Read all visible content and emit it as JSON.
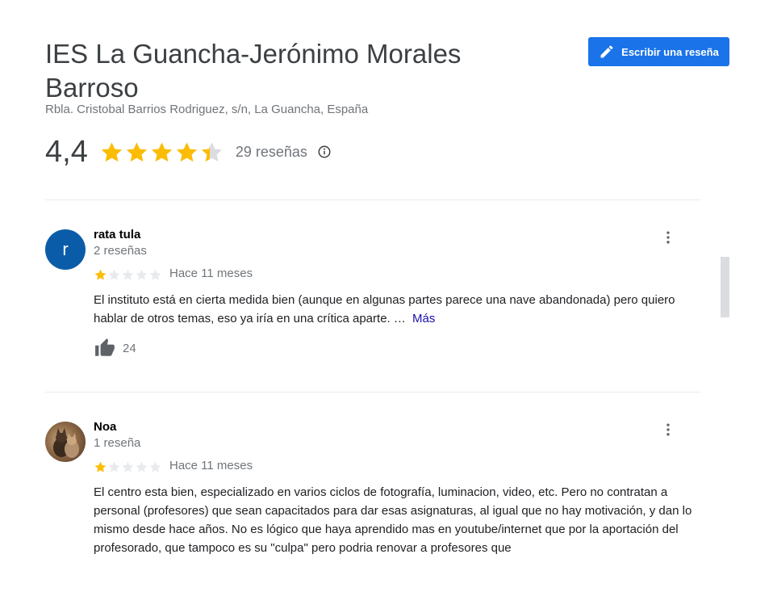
{
  "place": {
    "title": "IES La Guancha-Jerónimo Morales Barroso",
    "address": "Rbla. Cristobal Barrios Rodriguez, s/n, La Guancha, España",
    "rating": "4,4",
    "rating_value": 4.4,
    "reviews_count": "29 reseñas"
  },
  "toolbar": {
    "write_review_label": "Escribir una reseña"
  },
  "colors": {
    "accent": "#1a73e8",
    "star": "#fbbc04",
    "avatar_r": "#0b5ca8",
    "link": "#1a0dab"
  },
  "reviews": [
    {
      "avatar_letter": "r",
      "name": "rata tula",
      "count": "2 reseñas",
      "stars": 1,
      "date": "Hace 11 meses",
      "text": "El instituto está en cierta medida bien (aunque en algunas partes parece una nave abandonada) pero quiero hablar de otros temas, eso ya iría en una crítica aparte. …",
      "more_label": "Más",
      "likes": "24"
    },
    {
      "avatar_icon": "cat-photo-avatar",
      "name": "Noa",
      "count": "1 reseña",
      "stars": 1,
      "date": "Hace 11 meses",
      "text": "El centro esta bien, especializado en varios ciclos de fotografía, luminacion, video, etc. Pero no contratan a personal (profesores) que sean capacitados para dar esas asignaturas, al igual que no hay motivación, y dan lo mismo desde hace años. No es lógico que haya aprendido mas en youtube/internet que por la aportación del profesorado, que tampoco es su \"culpa\" pero podria renovar a profesores que"
    }
  ]
}
